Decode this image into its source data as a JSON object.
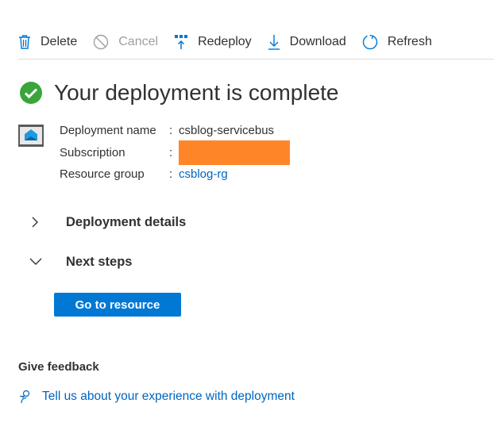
{
  "toolbar": {
    "delete_label": "Delete",
    "cancel_label": "Cancel",
    "redeploy_label": "Redeploy",
    "download_label": "Download",
    "refresh_label": "Refresh"
  },
  "header": {
    "title": "Your deployment is complete",
    "status_icon": "success-check-icon",
    "status_color": "#3aa53a"
  },
  "deployment": {
    "name_label": "Deployment name",
    "name_value": "csblog-servicebus",
    "subscription_label": "Subscription",
    "subscription_value": "",
    "resource_group_label": "Resource group",
    "resource_group_value": "csblog-rg",
    "separator": ":"
  },
  "sections": {
    "details_label": "Deployment details",
    "next_steps_label": "Next steps"
  },
  "actions": {
    "go_to_resource_label": "Go to resource"
  },
  "feedback": {
    "title": "Give feedback",
    "link_label": "Tell us about your experience with deployment"
  },
  "colors": {
    "accent": "#0078d4",
    "link": "#0064bf",
    "redaction": "#ff8628"
  }
}
